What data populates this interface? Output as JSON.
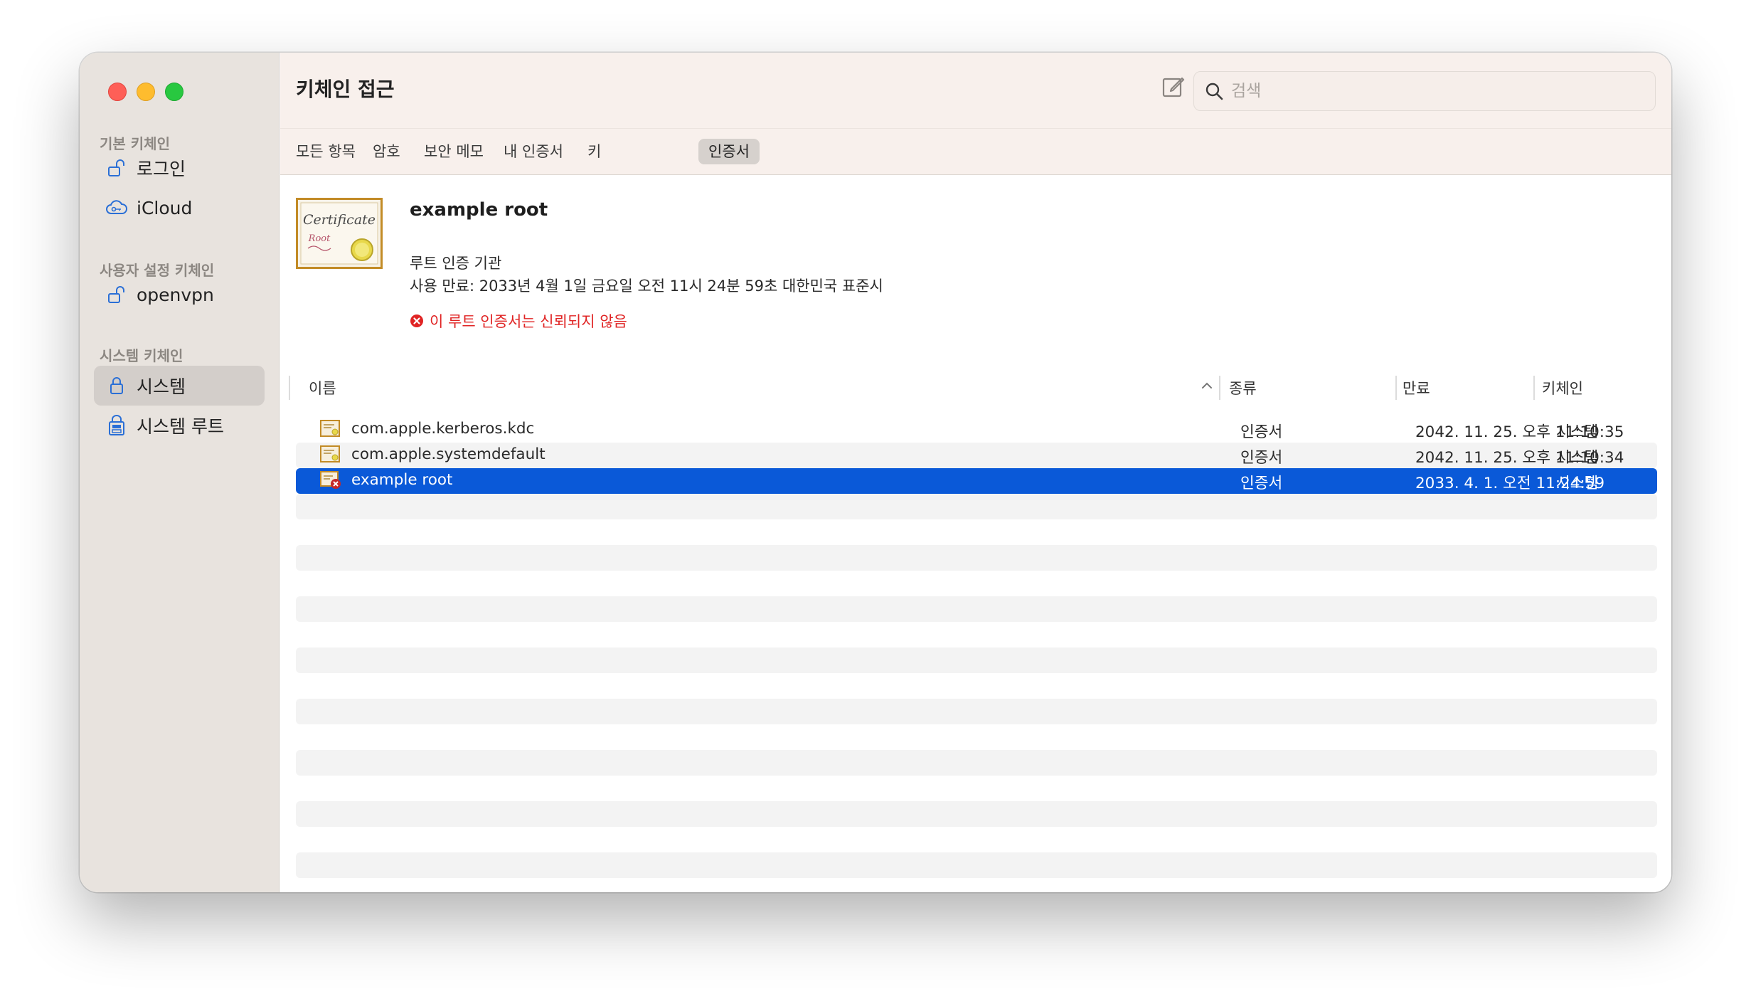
{
  "window": {
    "title": "키체인 접근"
  },
  "sidebar": {
    "sections": [
      {
        "label": "기본 키체인"
      },
      {
        "label": "사용자 설정 키체인"
      },
      {
        "label": "시스템 키체인"
      }
    ],
    "items": [
      {
        "label": "로그인",
        "icon": "unlocked-padlock-icon"
      },
      {
        "label": "iCloud",
        "icon": "cloud-key-icon"
      },
      {
        "label": "openvpn",
        "icon": "unlocked-padlock-icon"
      },
      {
        "label": "시스템",
        "icon": "locked-padlock-icon",
        "selected": true
      },
      {
        "label": "시스템 루트",
        "icon": "cabinet-lock-icon"
      }
    ]
  },
  "toolbar": {
    "compose_icon": "compose-icon",
    "info_icon": "info-icon",
    "search": {
      "placeholder": "검색",
      "value": ""
    }
  },
  "tabs": [
    {
      "label": "모든 항목"
    },
    {
      "label": "암호"
    },
    {
      "label": "보안 메모"
    },
    {
      "label": "내 인증서"
    },
    {
      "label": "키"
    },
    {
      "label": "인증서",
      "active": true
    }
  ],
  "certificate": {
    "icon_text": "Certificate",
    "icon_subtext": "Root",
    "name": "example root",
    "kind": "루트 인증 기관",
    "expiry": "사용 만료: 2033년 4월 1일 금요일 오전 11시 24분 59초 대한민국 표준시",
    "warning": "이 루트 인증서는 신뢰되지 않음"
  },
  "table": {
    "columns": {
      "name": "이름",
      "kind": "종류",
      "expires": "만료",
      "keychain": "키체인"
    },
    "sort_indicator": "chevron-up-icon",
    "rows": [
      {
        "name": "com.apple.kerberos.kdc",
        "kind": "인증서",
        "expires": "2042. 11. 25. 오후 11:10:35",
        "keychain": "시스템"
      },
      {
        "name": "com.apple.systemdefault",
        "kind": "인증서",
        "expires": "2042. 11. 25. 오후 11:10:34",
        "keychain": "시스템"
      },
      {
        "name": "example root",
        "kind": "인증서",
        "expires": "2033. 4. 1. 오전 11:24:59",
        "keychain": "시스템",
        "selected": true,
        "untrusted": true
      }
    ]
  },
  "colors": {
    "selection": "#0a59d8",
    "warning": "#e02424",
    "sidebar_bg": "#e8e3de",
    "toolbar_bg": "#f8f0ec"
  }
}
